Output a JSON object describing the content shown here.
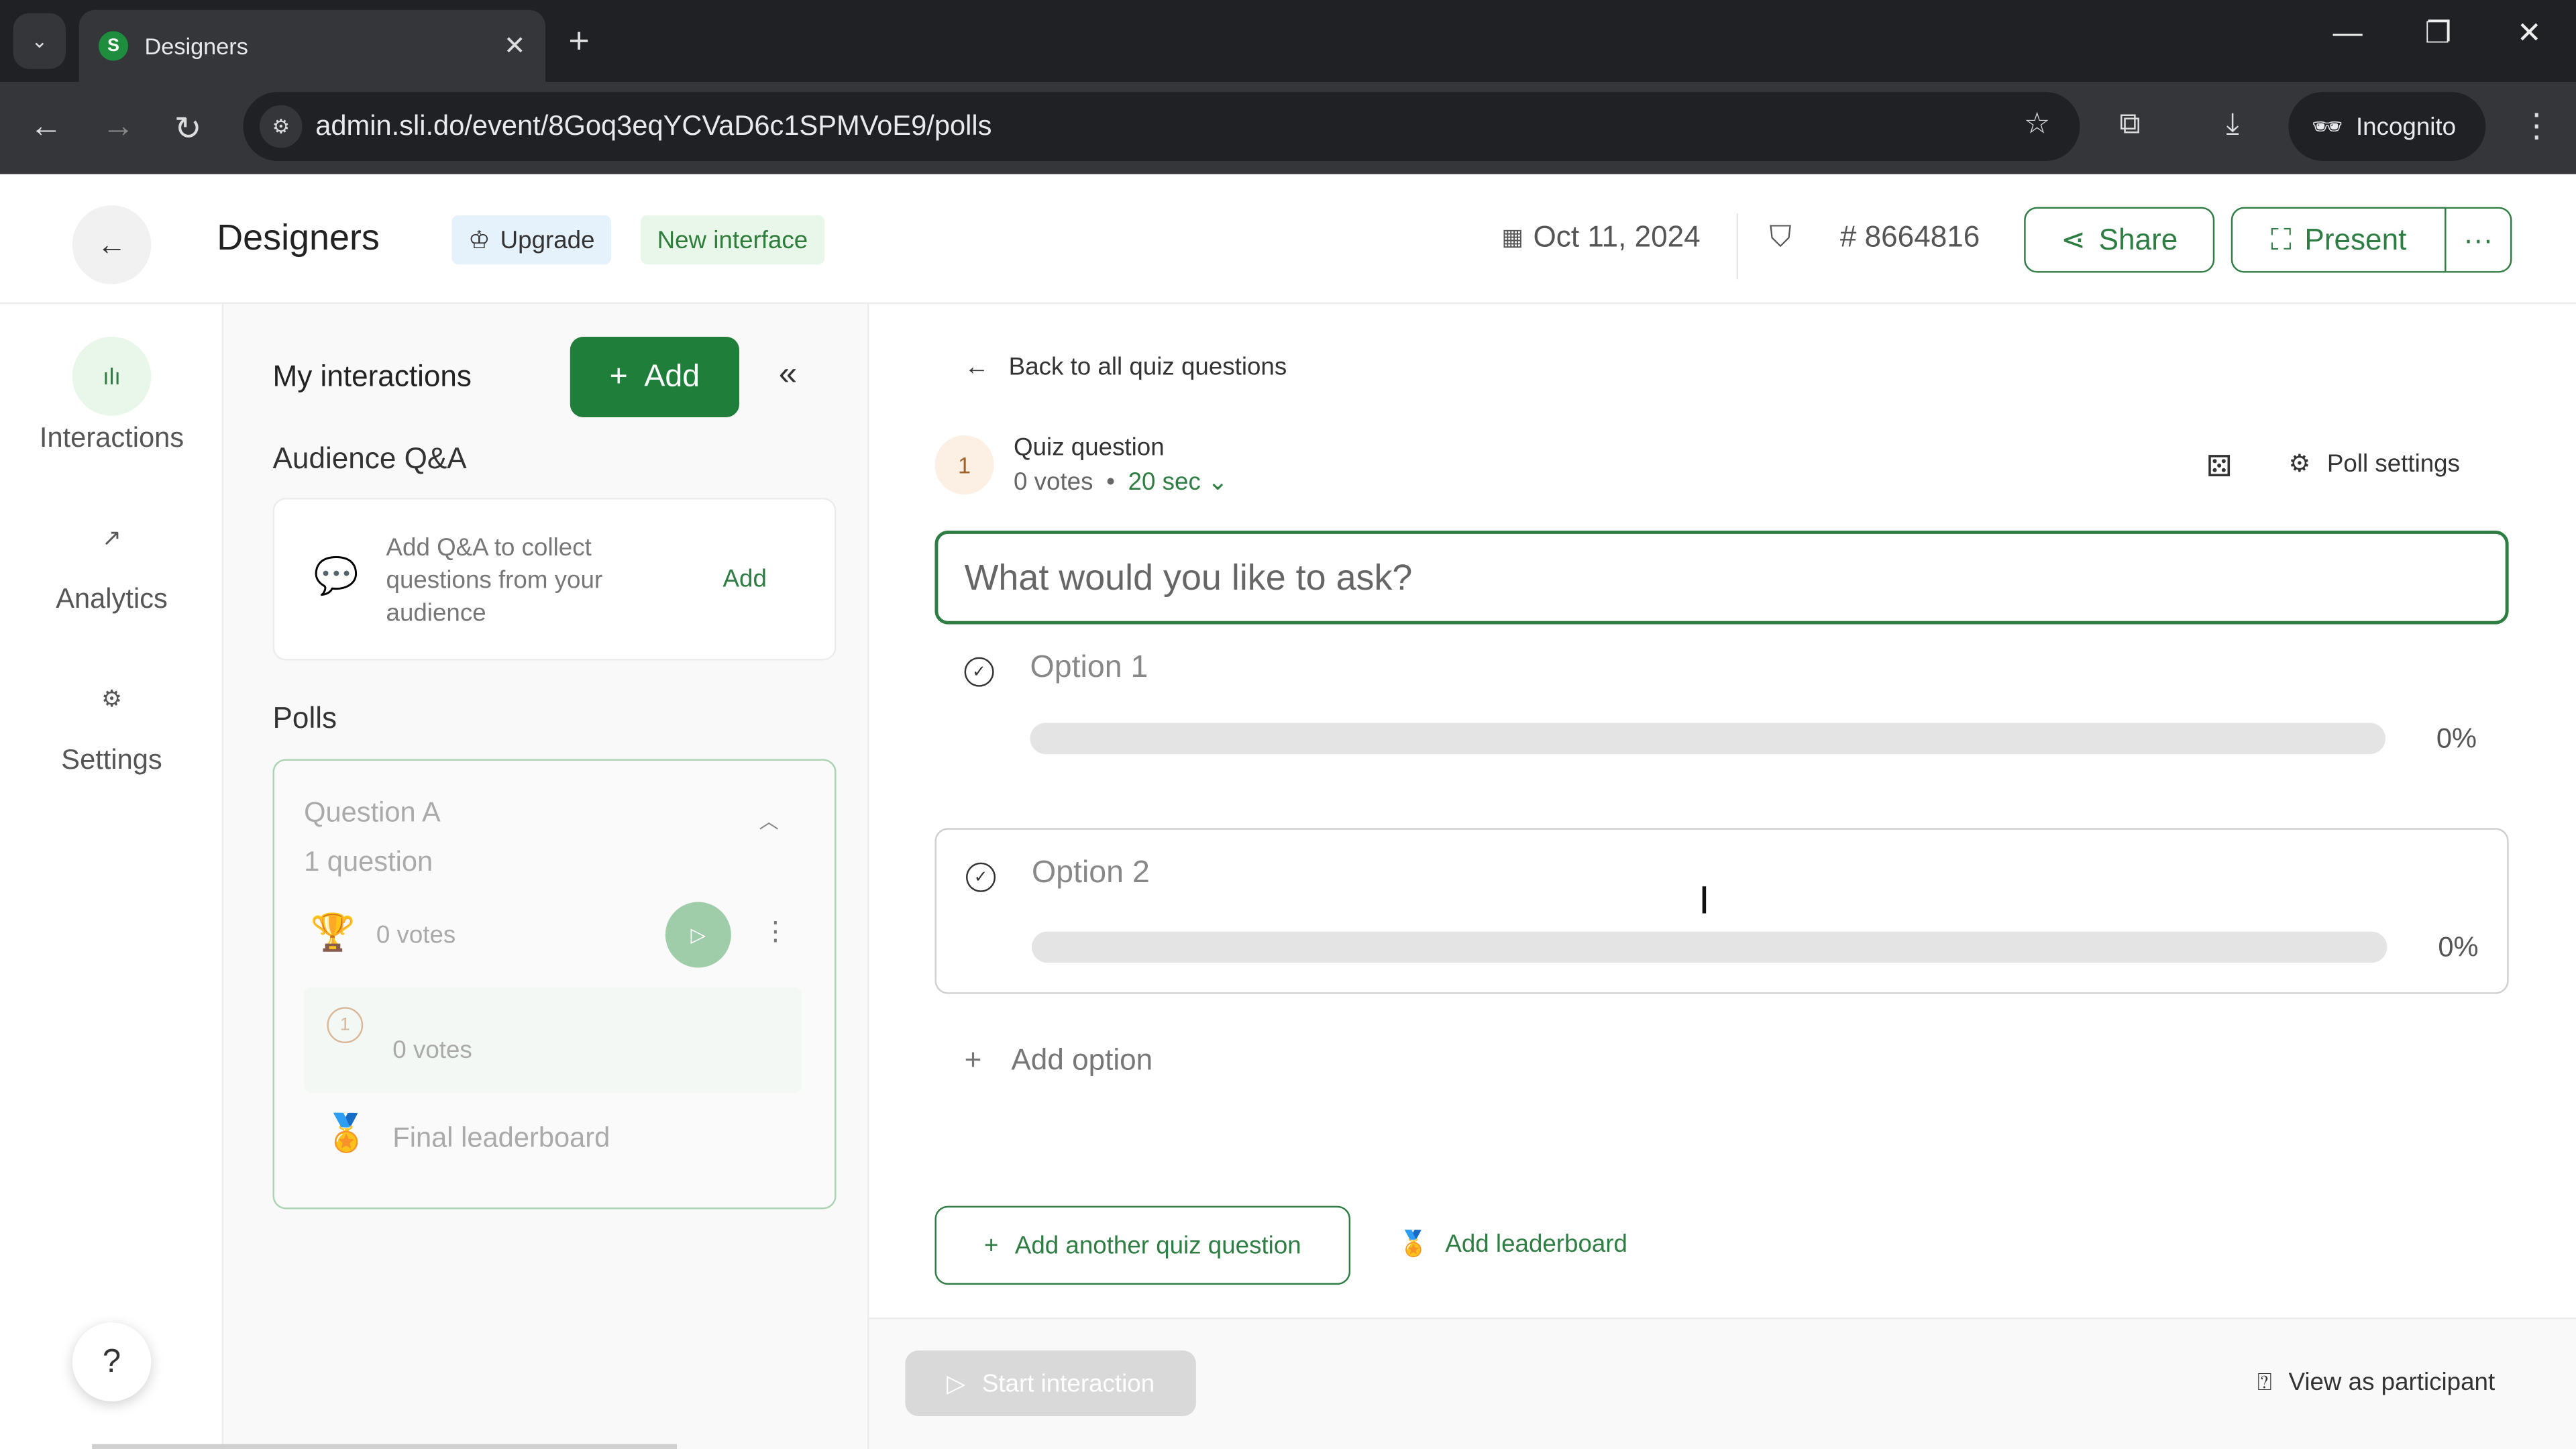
{
  "browser": {
    "tab_title": "Designers",
    "tab_favicon_letter": "S",
    "url": "admin.sli.do/event/8Goq3eqYCVaD6c1SPMVoE9/polls",
    "profile_label": "Incognito"
  },
  "header": {
    "event_title": "Designers",
    "upgrade_label": "Upgrade",
    "new_interface_label": "New interface",
    "date": "Oct 11, 2024",
    "event_code": "# 8664816",
    "share_label": "Share",
    "present_label": "Present",
    "more_label": "···"
  },
  "leftnav": {
    "items": [
      {
        "label": "Interactions",
        "icon": "bar-chart-icon",
        "active": true
      },
      {
        "label": "Analytics",
        "icon": "trend-up-icon",
        "active": false
      },
      {
        "label": "Settings",
        "icon": "gear-icon",
        "active": false
      }
    ],
    "help_label": "?"
  },
  "interactions_panel": {
    "title": "My interactions",
    "add_label": "Add",
    "qa_section_title": "Audience Q&A",
    "qa_card_text": "Add Q&A to collect questions from your audience",
    "qa_card_add": "Add",
    "polls_section_title": "Polls",
    "poll": {
      "title": "Question A",
      "count": "1 question",
      "votes": "0 votes",
      "question_number": "1",
      "question_votes": "0 votes",
      "leaderboard": "Final leaderboard"
    }
  },
  "main": {
    "back_link": "Back to all quiz questions",
    "question_number": "1",
    "question_type": "Quiz question",
    "votes": "0 votes",
    "separator": "•",
    "duration": "20 sec",
    "poll_settings_label": "Poll settings",
    "question_placeholder": "What would you like to ask?",
    "options": [
      {
        "label": "Option 1",
        "percent": "0%",
        "fraction": 0
      },
      {
        "label": "Option 2",
        "percent": "0%",
        "fraction": 0
      }
    ],
    "add_option_label": "Add option",
    "add_quiz_question_label": "Add another quiz question",
    "add_leaderboard_label": "Add leaderboard"
  },
  "footer": {
    "start_label": "Start interaction",
    "view_participant_label": "View as participant"
  },
  "colors": {
    "brand_green": "#1e7e3a",
    "accent_green": "#2e7d42"
  }
}
